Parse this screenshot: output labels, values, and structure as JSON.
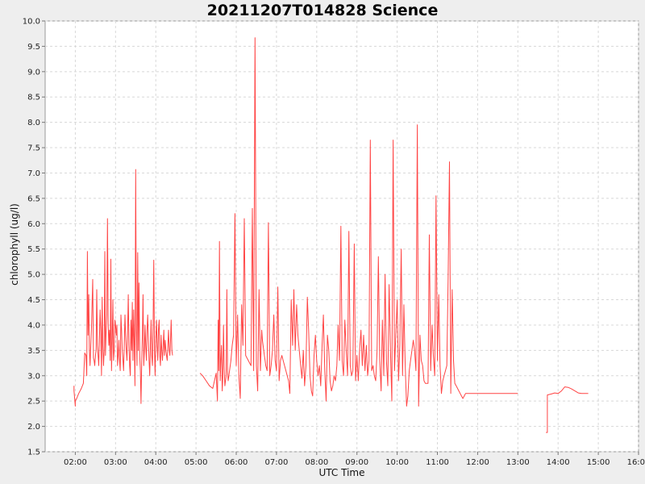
{
  "chart_data": {
    "type": "line",
    "title": "20211207T014828 Science",
    "xlabel": "UTC Time",
    "ylabel": "chlorophyll (ug/l)",
    "xlim": [
      "01:15",
      "16:00"
    ],
    "ylim": [
      1.5,
      10.0
    ],
    "grid": true,
    "x_ticks": [
      "02:00",
      "03:00",
      "04:00",
      "05:00",
      "06:00",
      "07:00",
      "08:00",
      "09:00",
      "10:00",
      "11:00",
      "12:00",
      "13:00",
      "14:00",
      "15:00",
      "16:00"
    ],
    "y_ticks": [
      "1.5",
      "2.0",
      "2.5",
      "3.0",
      "3.5",
      "4.0",
      "4.5",
      "5.0",
      "5.5",
      "6.0",
      "6.5",
      "7.0",
      "7.5",
      "8.0",
      "8.5",
      "9.0",
      "9.5",
      "10.0"
    ],
    "series_color": "#ff4444",
    "series": [
      {
        "name": "",
        "segments": [
          {
            "x": [
              "01:58",
              "01:58",
              "02:00",
              "02:00",
              "02:02",
              "02:05",
              "02:09",
              "02:12",
              "02:14",
              "02:16",
              "02:17",
              "02:18",
              "02:19",
              "02:20",
              "02:21",
              "02:22",
              "02:23",
              "02:24",
              "02:25",
              "02:26",
              "02:27",
              "02:28",
              "02:29",
              "02:30",
              "02:31",
              "02:32",
              "02:33",
              "02:35",
              "02:37",
              "02:38",
              "02:39",
              "02:40",
              "02:41",
              "02:42",
              "02:43",
              "02:44",
              "02:45",
              "02:46",
              "02:47",
              "02:48",
              "02:49",
              "02:50",
              "02:51",
              "02:52",
              "02:53",
              "02:54",
              "02:55",
              "02:56",
              "02:57",
              "02:58",
              "02:59",
              "03:00",
              "03:01",
              "03:02",
              "03:03",
              "03:04",
              "03:05",
              "03:06",
              "03:07",
              "03:08",
              "03:09",
              "03:10",
              "03:11",
              "03:12",
              "03:13",
              "03:14",
              "03:15",
              "03:16",
              "03:17",
              "03:18",
              "03:19",
              "03:20",
              "03:21",
              "03:22",
              "03:23",
              "03:24",
              "03:25",
              "03:26",
              "03:27",
              "03:28",
              "03:29",
              "03:30",
              "03:31",
              "03:32",
              "03:33",
              "03:34",
              "03:35",
              "03:36",
              "03:37",
              "03:38",
              "03:39",
              "03:40",
              "03:41",
              "03:42",
              "03:43",
              "03:44",
              "03:45",
              "03:46",
              "03:47",
              "03:48",
              "03:49",
              "03:50",
              "03:51",
              "03:52",
              "03:53",
              "03:54",
              "03:55",
              "03:56",
              "03:57",
              "03:58",
              "03:59",
              "04:00",
              "04:01",
              "04:02",
              "04:03",
              "04:04",
              "04:05",
              "04:06",
              "04:07",
              "04:08",
              "04:09",
              "04:10",
              "04:11",
              "04:12",
              "04:13",
              "04:14",
              "04:15",
              "04:16",
              "04:17",
              "04:18",
              "04:19",
              "04:20",
              "04:21",
              "04:22",
              "04:23",
              "04:24",
              "04:25"
            ],
            "y": [
              2.8,
              2.7,
              2.4,
              2.5,
              2.55,
              2.65,
              2.75,
              2.85,
              3.45,
              3.4,
              3.0,
              5.45,
              3.8,
              4.6,
              3.5,
              3.2,
              3.6,
              3.9,
              4.4,
              4.9,
              3.35,
              3.3,
              3.2,
              3.4,
              3.5,
              4.7,
              3.6,
              3.2,
              4.3,
              3.9,
              3.0,
              4.55,
              3.6,
              3.2,
              3.5,
              5.45,
              3.4,
              3.9,
              4.2,
              6.1,
              4.0,
              3.6,
              3.9,
              3.3,
              5.3,
              3.1,
              3.7,
              4.5,
              3.3,
              3.5,
              4.1,
              4.0,
              3.8,
              4.0,
              3.2,
              3.4,
              3.7,
              3.3,
              3.1,
              4.2,
              3.9,
              3.5,
              3.3,
              3.1,
              3.6,
              4.2,
              3.8,
              3.5,
              3.3,
              3.9,
              4.6,
              3.6,
              3.2,
              3.0,
              4.1,
              3.5,
              4.45,
              3.3,
              4.3,
              3.6,
              2.8,
              7.07,
              3.9,
              3.2,
              5.43,
              3.5,
              4.83,
              3.4,
              3.1,
              2.45,
              3.3,
              3.8,
              4.6,
              3.2,
              3.5,
              4.0,
              3.6,
              3.3,
              3.9,
              4.2,
              3.7,
              3.3,
              3.0,
              3.6,
              4.1,
              3.4,
              3.2,
              4.0,
              5.28,
              3.5,
              3.0,
              3.7,
              4.1,
              3.6,
              3.3,
              3.9,
              4.1,
              3.4,
              3.2,
              3.8,
              3.5,
              3.3,
              3.6,
              3.9,
              3.4,
              3.7,
              3.5,
              3.4,
              3.3,
              3.6,
              3.9,
              3.5,
              3.4,
              3.7,
              4.1,
              3.5,
              3.4,
              3.8
            ]
          },
          {
            "x": [
              "05:06",
              "05:10",
              "05:15",
              "05:20",
              "05:25",
              "05:30",
              "05:32",
              "05:33",
              "05:34",
              "05:35",
              "05:36",
              "05:37",
              "05:38",
              "05:39",
              "05:40",
              "05:41",
              "05:42",
              "05:43",
              "05:44",
              "05:45",
              "05:46",
              "05:47",
              "05:48",
              "05:49",
              "05:50",
              "05:52",
              "05:54",
              "05:56",
              "05:58",
              "06:00",
              "06:02",
              "06:04",
              "06:06",
              "06:08",
              "06:10",
              "06:12",
              "06:14",
              "06:16",
              "06:18",
              "06:20",
              "06:22",
              "06:24",
              "06:26",
              "06:28",
              "06:30",
              "06:32",
              "06:34",
              "06:36",
              "06:38",
              "06:39",
              "06:40",
              "06:41",
              "06:42",
              "06:43",
              "06:44",
              "06:46",
              "06:48",
              "06:50",
              "06:52",
              "06:54",
              "06:56",
              "06:58",
              "07:00",
              "07:02",
              "07:04",
              "07:06",
              "07:08",
              "07:10",
              "07:12",
              "07:14",
              "07:16",
              "07:18",
              "07:20",
              "07:22",
              "07:24",
              "07:26",
              "07:28",
              "07:30",
              "07:32",
              "07:34",
              "07:36",
              "07:38",
              "07:40",
              "07:42",
              "07:44",
              "07:46",
              "07:48",
              "07:50",
              "07:52",
              "07:54",
              "07:56",
              "07:58",
              "08:00",
              "08:02",
              "08:04",
              "08:06",
              "08:08",
              "08:10",
              "08:12",
              "08:14",
              "08:16",
              "08:18",
              "08:20",
              "08:22",
              "08:24",
              "08:26",
              "08:28",
              "08:30",
              "08:32",
              "08:34",
              "08:36",
              "08:38",
              "08:40",
              "08:42",
              "08:44",
              "08:46",
              "08:48",
              "08:50",
              "08:52",
              "08:54",
              "08:56",
              "08:58",
              "09:00",
              "09:02",
              "09:04",
              "09:06",
              "09:08",
              "09:10",
              "09:12",
              "09:14",
              "09:16",
              "09:18",
              "09:20",
              "09:22",
              "09:24",
              "09:26",
              "09:28",
              "09:30",
              "09:32",
              "09:34",
              "09:36",
              "09:38",
              "09:40",
              "09:42",
              "09:44",
              "09:46",
              "09:48",
              "09:50",
              "09:52",
              "09:54",
              "09:56",
              "09:58",
              "10:00",
              "10:02",
              "10:04",
              "10:06",
              "10:08",
              "10:10",
              "10:12",
              "10:14",
              "10:16",
              "10:18",
              "10:20",
              "10:22",
              "10:24",
              "10:26",
              "10:28",
              "10:30",
              "10:32",
              "10:34",
              "10:36",
              "10:38",
              "10:40",
              "10:42",
              "10:44",
              "10:46",
              "10:48",
              "10:50",
              "10:52",
              "10:54",
              "10:56",
              "10:58",
              "11:00",
              "11:02",
              "11:04",
              "11:06",
              "11:08",
              "11:10",
              "11:12",
              "11:14",
              "11:16",
              "11:18",
              "11:20",
              "11:22",
              "11:24",
              "11:26",
              "11:28",
              "11:30",
              "11:32",
              "11:34",
              "11:36",
              "11:38",
              "11:40",
              "11:42",
              "11:44",
              "11:46",
              "11:48",
              "11:50",
              "11:52",
              "11:54",
              "11:56",
              "11:58",
              "12:00",
              "12:02",
              "12:04",
              "12:06",
              "12:08",
              "12:10",
              "12:12",
              "12:14",
              "12:16",
              "12:18",
              "12:20",
              "12:22",
              "12:24",
              "12:26",
              "12:28",
              "12:30",
              "12:35",
              "12:40",
              "12:45",
              "12:50",
              "12:55",
              "13:00",
              "13:02",
              "13:05"
            ],
            "y": [
              3.05,
              3.0,
              2.9,
              2.8,
              2.75,
              3.05,
              2.5,
              4.1,
              3.1,
              5.65,
              2.9,
              3.3,
              3.6,
              2.7,
              3.0,
              4.0,
              3.2,
              2.8,
              2.9,
              3.0,
              4.7,
              3.1,
              2.9,
              3.0,
              3.1,
              3.3,
              3.6,
              3.8,
              6.2,
              3.2,
              4.2,
              3.0,
              2.55,
              4.4,
              3.6,
              6.1,
              3.4,
              3.35,
              3.3,
              3.25,
              3.2,
              6.3,
              3.1,
              9.67,
              3.2,
              2.7,
              4.7,
              3.1,
              3.9,
              3.7,
              3.6,
              3.5,
              3.4,
              3.3,
              3.2,
              3.1,
              6.02,
              3.0,
              3.2,
              3.5,
              4.2,
              3.3,
              3.1,
              4.75,
              2.9,
              3.3,
              3.4,
              3.3,
              3.2,
              3.1,
              3.0,
              2.9,
              2.65,
              4.5,
              3.6,
              4.7,
              3.5,
              4.4,
              3.8,
              3.5,
              3.2,
              2.95,
              3.5,
              2.8,
              3.2,
              4.55,
              3.9,
              3.0,
              2.7,
              2.6,
              3.4,
              3.8,
              3.3,
              3.0,
              3.2,
              2.8,
              3.6,
              4.2,
              3.1,
              2.5,
              3.8,
              3.5,
              2.9,
              2.7,
              2.8,
              3.0,
              2.9,
              3.2,
              4.0,
              3.3,
              5.95,
              3.3,
              3.0,
              4.1,
              3.5,
              3.0,
              5.85,
              3.2,
              3.0,
              3.1,
              5.6,
              2.9,
              3.4,
              2.9,
              3.5,
              3.9,
              3.2,
              3.8,
              3.1,
              3.6,
              3.0,
              3.3,
              7.65,
              3.1,
              3.2,
              3.0,
              2.9,
              3.5,
              5.35,
              3.3,
              2.7,
              4.1,
              3.0,
              5.0,
              3.3,
              2.8,
              4.8,
              3.5,
              2.5,
              7.65,
              3.1,
              3.8,
              4.5,
              2.9,
              3.6,
              5.5,
              3.0,
              4.4,
              3.2,
              2.4,
              2.6,
              3.1,
              3.3,
              3.5,
              3.7,
              3.5,
              3.1,
              7.95,
              2.4,
              3.8,
              3.3,
              3.2,
              2.9,
              2.85,
              2.85,
              2.85,
              5.78,
              3.1,
              4.0,
              3.4,
              3.0,
              6.55,
              3.3,
              4.6,
              3.2,
              2.65,
              2.9,
              3.0,
              3.1,
              3.2,
              4.9,
              7.22,
              2.65,
              4.7,
              3.3,
              2.85,
              2.8,
              2.75,
              2.7,
              2.65,
              2.6,
              2.55,
              2.6,
              2.65,
              2.65,
              2.65,
              2.65,
              2.65,
              2.65,
              2.65,
              2.65,
              2.65,
              2.65,
              2.65,
              2.65,
              2.65,
              2.65,
              2.65,
              2.65,
              2.65,
              2.65,
              2.65,
              2.65,
              2.65,
              2.65,
              2.65,
              2.65,
              2.65,
              2.65,
              2.65,
              2.65,
              2.65,
              2.65,
              2.65
            ]
          },
          {
            "x": [
              "13:42",
              "13:44",
              "13:44",
              "13:50",
              "13:55",
              "14:00",
              "14:05",
              "14:10",
              "14:15",
              "14:20",
              "14:25",
              "14:30",
              "14:35",
              "14:40",
              "14:45"
            ],
            "y": [
              1.88,
              1.88,
              2.62,
              2.64,
              2.66,
              2.65,
              2.7,
              2.78,
              2.77,
              2.74,
              2.7,
              2.66,
              2.65,
              2.65,
              2.65
            ]
          }
        ]
      }
    ]
  }
}
